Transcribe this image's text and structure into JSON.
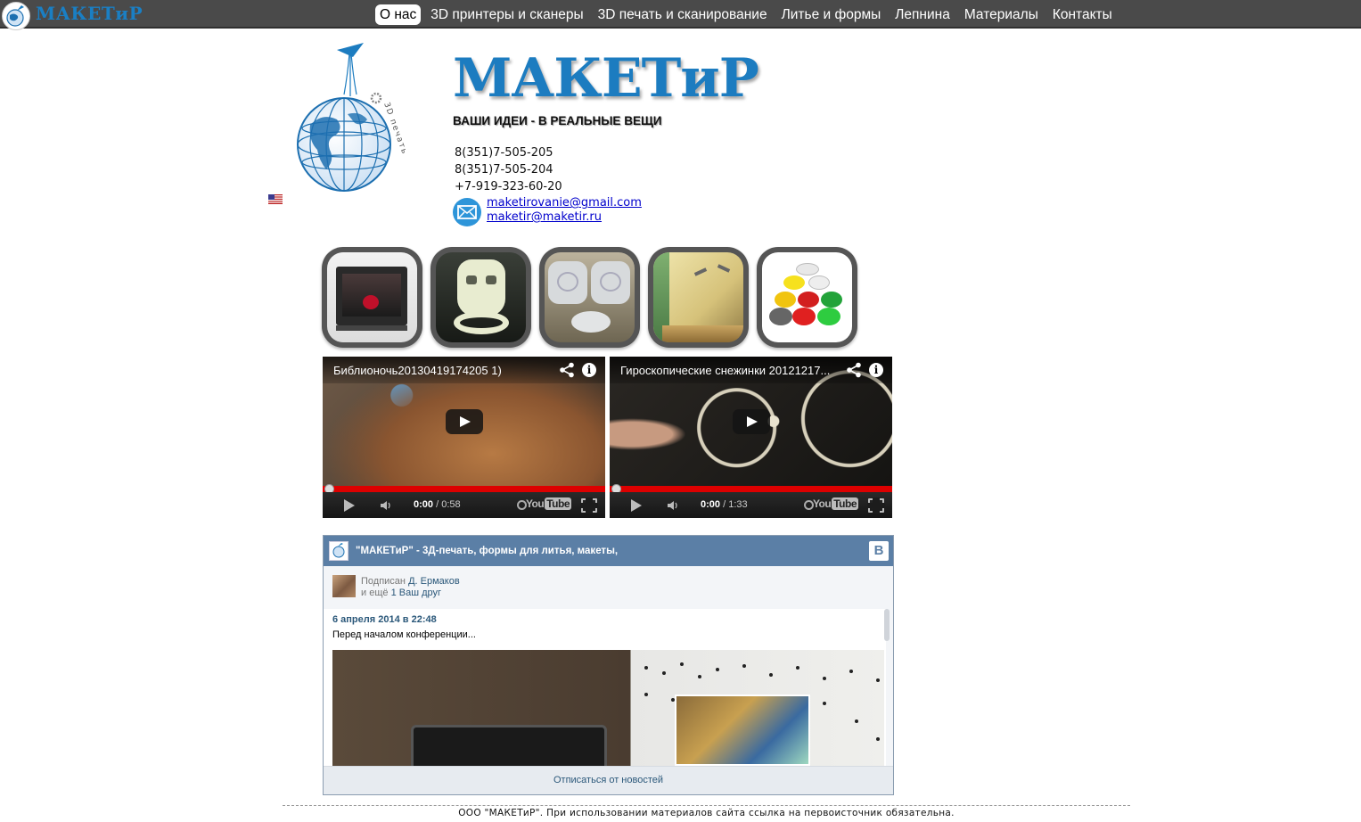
{
  "brand": {
    "name": "МАКЕТиР"
  },
  "nav": {
    "items": [
      {
        "label": "О нас",
        "active": true
      },
      {
        "label": "3D принтеры и сканеры",
        "active": false
      },
      {
        "label": "3D печать и сканирование",
        "active": false
      },
      {
        "label": "Литье и формы",
        "active": false
      },
      {
        "label": "Лепнина",
        "active": false
      },
      {
        "label": "Материалы",
        "active": false
      },
      {
        "label": "Контакты",
        "active": false
      }
    ]
  },
  "header": {
    "title": "МАКЕТиР",
    "tagline": "ВАШИ ИДЕИ - В РЕАЛЬНЫЕ ВЕЩИ",
    "globe_caption": "3D печать",
    "phones": [
      "8(351)7-505-205",
      "8(351)7-505-204",
      "+7-919-323-60-20"
    ],
    "emails": [
      "maketirovanie@gmail.com",
      "maketir@maketir.ru"
    ]
  },
  "tiles": [
    {
      "icon": "3d-printer-image"
    },
    {
      "icon": "white-3d-print-mask-image"
    },
    {
      "icon": "casting-molds-image"
    },
    {
      "icon": "stucco-wall-image"
    },
    {
      "icon": "filament-spools-image"
    }
  ],
  "videos": [
    {
      "title": "Библионочь20130419174205 1)",
      "time_current": "0:00",
      "time_total": "0:58"
    },
    {
      "title": "Гироскопические снежинки 20121217...",
      "time_current": "0:00",
      "time_total": "1:33"
    }
  ],
  "vk": {
    "title": "\"МАКЕТиР\" - 3Д-печать, формы для литья, макеты,",
    "logo": "В",
    "subscribed_prefix": "Подписан",
    "subscribed_name": "Д. Ермаков",
    "and_more_prefix": "и ещё",
    "and_more_link": "1 Ваш друг",
    "post_date": "6 апреля 2014 в 22:48",
    "post_text": "Перед началом конференции...",
    "unsubscribe": "Отписаться от новостей"
  },
  "footer": {
    "text": "ООО \"МАКЕТиР\". При использовании материалов сайта ссылка на первоисточник обязательна."
  },
  "colors": {
    "nav_bg": "#4a4a4a",
    "brand_blue": "#1c7cc0",
    "vk_blue": "#5b7fa6",
    "progress_red": "#dd0000"
  }
}
